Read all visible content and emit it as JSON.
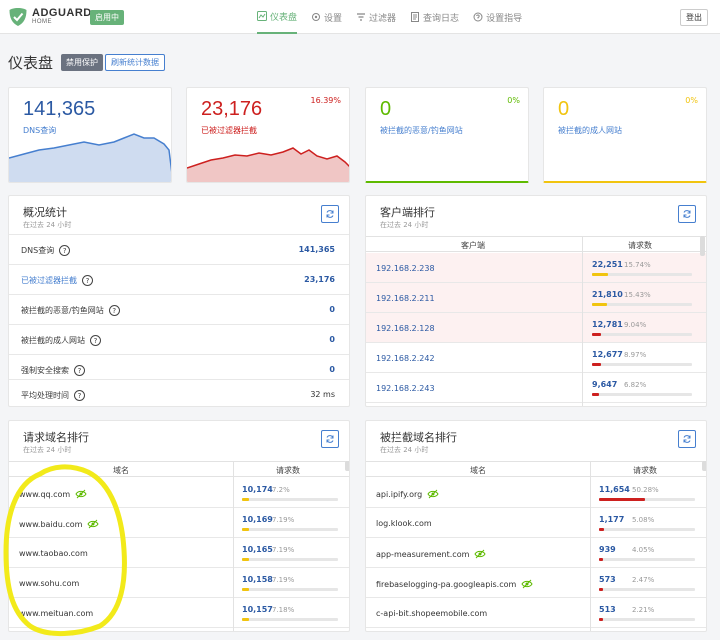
{
  "header": {
    "brand": "ADGUARD",
    "brand_sub": "HOME",
    "status_badge": "启用中",
    "nav": [
      {
        "label": "仪表盘",
        "icon": "dashboard-icon",
        "active": true
      },
      {
        "label": "设置",
        "icon": "gear-icon",
        "active": false
      },
      {
        "label": "过滤器",
        "icon": "filter-icon",
        "active": false
      },
      {
        "label": "查询日志",
        "icon": "log-icon",
        "active": false
      },
      {
        "label": "设置指导",
        "icon": "help-icon",
        "active": false
      }
    ],
    "logout": "登出"
  },
  "page": {
    "title": "仪表盘",
    "disable_protection": "禁用保护",
    "refresh_stats": "刷新统计数据"
  },
  "stats": [
    {
      "value": "141,365",
      "label": "DNS查询",
      "pct": "",
      "color": "#467fcf"
    },
    {
      "value": "23,176",
      "label": "已被过滤器拦截",
      "pct": "16.39%",
      "color": "#cd201f"
    },
    {
      "value": "0",
      "label": "被拦截的恶意/钓鱼网站",
      "pct": "0%",
      "color": "#5eba00"
    },
    {
      "value": "0",
      "label": "被拦截的成人网站",
      "pct": "0%",
      "color": "#f1c40f"
    }
  ],
  "overview": {
    "title": "概况统计",
    "subtitle": "在过去 24 小时",
    "rows": [
      {
        "label": "DNS查询",
        "value": "141,365"
      },
      {
        "label": "已被过滤器拦截",
        "value": "23,176"
      },
      {
        "label": "被拦截的恶意/钓鱼网站",
        "value": "0"
      },
      {
        "label": "被拦截的成人网站",
        "value": "0"
      },
      {
        "label": "强制安全搜索",
        "value": "0"
      },
      {
        "label": "平均处理时间",
        "value": "32 ms"
      }
    ]
  },
  "clients": {
    "title": "客户端排行",
    "subtitle": "在过去 24 小时",
    "col_name": "客户端",
    "col_count": "请求数",
    "rows": [
      {
        "name": "192.168.2.238",
        "count": "22,251",
        "pct": "15.74%",
        "ratio": 0.1574,
        "highlight": true
      },
      {
        "name": "192.168.2.211",
        "count": "21,810",
        "pct": "15.43%",
        "ratio": 0.1543,
        "highlight": true
      },
      {
        "name": "192.168.2.128",
        "count": "12,781",
        "pct": "9.04%",
        "ratio": 0.0904,
        "highlight": true
      },
      {
        "name": "192.168.2.242",
        "count": "12,677",
        "pct": "8.97%",
        "ratio": 0.0897,
        "highlight": false
      },
      {
        "name": "192.168.2.243",
        "count": "9,647",
        "pct": "6.82%",
        "ratio": 0.0682,
        "highlight": false
      }
    ]
  },
  "domains": {
    "title": "请求域名排行",
    "subtitle": "在过去 24 小时",
    "col_name": "域名",
    "col_count": "请求数",
    "rows": [
      {
        "name": "www.qq.com",
        "count": "10,174",
        "pct": "7.2%",
        "ratio": 0.072,
        "eye": true
      },
      {
        "name": "www.baidu.com",
        "count": "10,169",
        "pct": "7.19%",
        "ratio": 0.0719,
        "eye": true
      },
      {
        "name": "www.taobao.com",
        "count": "10,165",
        "pct": "7.19%",
        "ratio": 0.0719,
        "eye": false
      },
      {
        "name": "www.sohu.com",
        "count": "10,158",
        "pct": "7.19%",
        "ratio": 0.0719,
        "eye": false
      },
      {
        "name": "www.meituan.com",
        "count": "10,157",
        "pct": "7.18%",
        "ratio": 0.0718,
        "eye": false
      }
    ]
  },
  "blocked": {
    "title": "被拦截域名排行",
    "subtitle": "在过去 24 小时",
    "col_name": "域名",
    "col_count": "请求数",
    "rows": [
      {
        "name": "api.ipify.org",
        "count": "11,654",
        "pct": "50.28%",
        "ratio": 0.5028,
        "eye": true
      },
      {
        "name": "log.klook.com",
        "count": "1,177",
        "pct": "5.08%",
        "ratio": 0.0508,
        "eye": false
      },
      {
        "name": "app-measurement.com",
        "count": "939",
        "pct": "4.05%",
        "ratio": 0.0405,
        "eye": true
      },
      {
        "name": "firebaselogging-pa.googleapis.com",
        "count": "573",
        "pct": "2.47%",
        "ratio": 0.0247,
        "eye": true
      },
      {
        "name": "c-api-bit.shopeemobile.com",
        "count": "513",
        "pct": "2.21%",
        "ratio": 0.0221,
        "eye": false
      }
    ]
  }
}
